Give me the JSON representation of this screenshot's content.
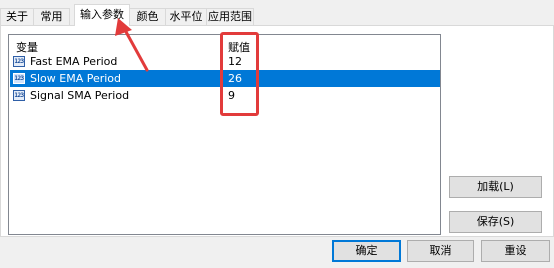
{
  "tabs": [
    {
      "label": "关于"
    },
    {
      "label": "常用"
    },
    {
      "label": "输入参数"
    },
    {
      "label": "颜色"
    },
    {
      "label": "水平位"
    },
    {
      "label": "应用范围"
    }
  ],
  "table": {
    "headers": {
      "variable": "变量",
      "value": "赋值"
    },
    "rows": [
      {
        "icon": "123",
        "name": "Fast EMA Period",
        "value": "12",
        "selected": false
      },
      {
        "icon": "123",
        "name": "Slow EMA Period",
        "value": "26",
        "selected": true
      },
      {
        "icon": "123",
        "name": "Signal SMA Period",
        "value": "9",
        "selected": false
      }
    ]
  },
  "side_buttons": {
    "load": "加载(L)",
    "save": "保存(S)"
  },
  "footer_buttons": {
    "ok": "确定",
    "cancel": "取消",
    "reset": "重设"
  },
  "colors": {
    "selection": "#0078d7",
    "annotation": "#e23b3b"
  }
}
